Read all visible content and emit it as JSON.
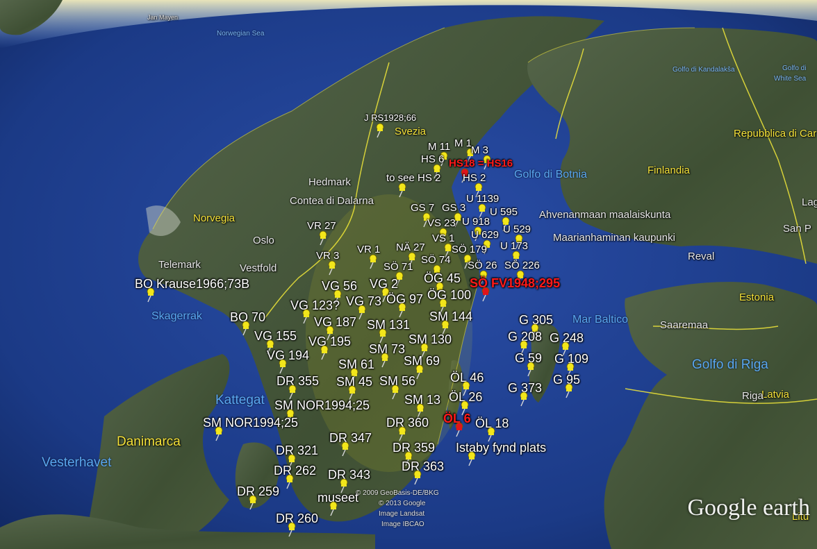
{
  "map": {
    "app": "Google earth",
    "credits": [
      "© 2009 GeoBasis-DE/BKG",
      "© 2013 Google",
      "Image Landsat",
      "Image IBCAO"
    ],
    "water_labels": [
      "Norwegian Sea",
      "Golfo di Botnia",
      "Skagerrak",
      "Kattegat",
      "Vesterhavet",
      "Mar Baltico",
      "Golfo di Riga",
      "Golfo di Kandalakša",
      "White Sea",
      "Golfo di"
    ],
    "country_labels": [
      "Norvegia",
      "Svezia",
      "Finlandia",
      "Danimarca",
      "Estonia",
      "Latvia",
      "Litu",
      "Repubblica di Car"
    ],
    "place_labels": [
      "Jan Mayen",
      "Hedmark",
      "Contea di Dalarna",
      "Oslo",
      "Vestfold",
      "Telemark",
      "Ahvenanmaan maalaiskunta",
      "Maarianhaminan kaupunki",
      "Reval",
      "San P",
      "Saaremaa",
      "Riga",
      "Lag"
    ],
    "pins": [
      {
        "label": "J RS1928;66",
        "flag": "yellow"
      },
      {
        "label": "M 11",
        "flag": "yellow"
      },
      {
        "label": "M 1",
        "flag": "yellow"
      },
      {
        "label": "M 3",
        "flag": "yellow"
      },
      {
        "label": "HS 6",
        "flag": "yellow"
      },
      {
        "label": "HS18 = HS16",
        "flag": "red"
      },
      {
        "label": "to see HS 2",
        "flag": "yellow"
      },
      {
        "label": "HS 2",
        "flag": "yellow"
      },
      {
        "label": "U 1139",
        "flag": "yellow"
      },
      {
        "label": "GS 7",
        "flag": "yellow"
      },
      {
        "label": "GS 3",
        "flag": "yellow"
      },
      {
        "label": "U 595",
        "flag": "yellow"
      },
      {
        "label": "VS 23",
        "flag": "yellow"
      },
      {
        "label": "U 918",
        "flag": "yellow"
      },
      {
        "label": "U 629",
        "flag": "yellow"
      },
      {
        "label": "U 529",
        "flag": "yellow"
      },
      {
        "label": "VR 27",
        "flag": "yellow"
      },
      {
        "label": "VS 1",
        "flag": "yellow"
      },
      {
        "label": "U 173",
        "flag": "yellow"
      },
      {
        "label": "NÄ 27",
        "flag": "yellow"
      },
      {
        "label": "SÖ 179",
        "flag": "yellow"
      },
      {
        "label": "VR 1",
        "flag": "yellow"
      },
      {
        "label": "VR 3",
        "flag": "yellow"
      },
      {
        "label": "SÖ 74",
        "flag": "yellow"
      },
      {
        "label": "SÖ 71",
        "flag": "yellow"
      },
      {
        "label": "SÖ 26",
        "flag": "yellow"
      },
      {
        "label": "SÖ 226",
        "flag": "yellow"
      },
      {
        "label": "BO Krause1966;73B",
        "flag": "yellow"
      },
      {
        "label": "ÖG 45",
        "flag": "yellow"
      },
      {
        "label": "SÖ FV1948;295",
        "flag": "red"
      },
      {
        "label": "VG 56",
        "flag": "yellow"
      },
      {
        "label": "VG 2",
        "flag": "yellow"
      },
      {
        "label": "ÖG 100",
        "flag": "yellow"
      },
      {
        "label": "VG 123?",
        "flag": "yellow"
      },
      {
        "label": "VG 73",
        "flag": "yellow"
      },
      {
        "label": "ÖG 97",
        "flag": "yellow"
      },
      {
        "label": "BO 70",
        "flag": "yellow"
      },
      {
        "label": "SM 144",
        "flag": "yellow"
      },
      {
        "label": "G 305",
        "flag": "yellow"
      },
      {
        "label": "VG 187",
        "flag": "yellow"
      },
      {
        "label": "SM 131",
        "flag": "yellow"
      },
      {
        "label": "VG 155",
        "flag": "yellow"
      },
      {
        "label": "G 208",
        "flag": "yellow"
      },
      {
        "label": "G 248",
        "flag": "yellow"
      },
      {
        "label": "VG 195",
        "flag": "yellow"
      },
      {
        "label": "SM 130",
        "flag": "yellow"
      },
      {
        "label": "SM 73",
        "flag": "yellow"
      },
      {
        "label": "VG 194",
        "flag": "yellow"
      },
      {
        "label": "G 59",
        "flag": "yellow"
      },
      {
        "label": "G 109",
        "flag": "yellow"
      },
      {
        "label": "SM 61",
        "flag": "yellow"
      },
      {
        "label": "SM 69",
        "flag": "yellow"
      },
      {
        "label": "ÖL 46",
        "flag": "yellow"
      },
      {
        "label": "G 95",
        "flag": "yellow"
      },
      {
        "label": "DR 355",
        "flag": "yellow"
      },
      {
        "label": "SM 45",
        "flag": "yellow"
      },
      {
        "label": "SM 56",
        "flag": "yellow"
      },
      {
        "label": "G 373",
        "flag": "yellow"
      },
      {
        "label": "SM NOR1994;25",
        "flag": "yellow"
      },
      {
        "label": "SM 13",
        "flag": "yellow"
      },
      {
        "label": "ÖL 26",
        "flag": "yellow"
      },
      {
        "label": "SM NOR1994;25",
        "flag": "yellow"
      },
      {
        "label": "DR 360",
        "flag": "yellow"
      },
      {
        "label": "ÖL 6",
        "flag": "red"
      },
      {
        "label": "ÖL 18",
        "flag": "yellow"
      },
      {
        "label": "DR 347",
        "flag": "yellow"
      },
      {
        "label": "DR 321",
        "flag": "yellow"
      },
      {
        "label": "DR 359",
        "flag": "yellow"
      },
      {
        "label": "Istaby fynd plats",
        "flag": "yellow"
      },
      {
        "label": "DR 363",
        "flag": "yellow"
      },
      {
        "label": "DR 262",
        "flag": "yellow"
      },
      {
        "label": "DR 343",
        "flag": "yellow"
      },
      {
        "label": "DR 259",
        "flag": "yellow"
      },
      {
        "label": "museet",
        "flag": "yellow"
      },
      {
        "label": "DR 260",
        "flag": "yellow"
      }
    ],
    "colors": {
      "pin_yellow": "#f2e61b",
      "pin_red": "#e0141b",
      "border": "#f0e63a",
      "land": "#4a5a3a",
      "sea": "#1f3d8a"
    }
  }
}
